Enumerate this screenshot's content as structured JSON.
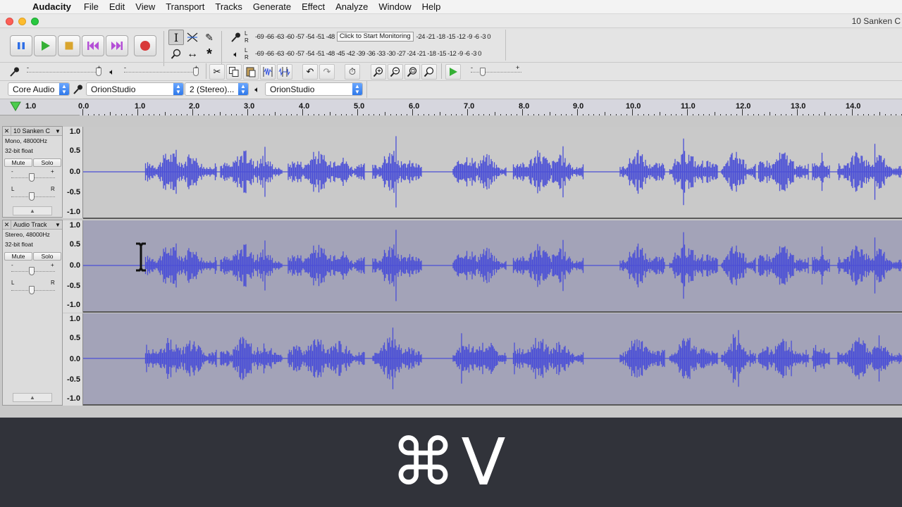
{
  "menubar": {
    "apple_glyph": "",
    "app_name": "Audacity",
    "items": [
      "File",
      "Edit",
      "View",
      "Transport",
      "Tracks",
      "Generate",
      "Effect",
      "Analyze",
      "Window",
      "Help"
    ]
  },
  "window": {
    "title": "10 Sanken C"
  },
  "meters": {
    "record_scale": "-69 -66 -63 -60 -57 -54 -51 -48",
    "record_tooltip": "Click to Start Monitoring",
    "record_scale_right": "-24 -21 -18 -15 -12  -9  -6  -3  0",
    "playback_scale": "-69 -66 -63 -60 -57 -54 -51 -48 -45 -42 -39 -36 -33 -30 -27 -24 -21 -18 -15 -12  -9  -6  -3  0",
    "lr_left": "L",
    "lr_right": "R"
  },
  "slider_marks": {
    "minus": "-",
    "plus": "+"
  },
  "devices": {
    "host": "Core Audio",
    "recording_device": "OrionStudio",
    "channels": "2 (Stereo)...",
    "playback_device": "OrionStudio"
  },
  "timeline": {
    "left_label": "1.0",
    "marks": [
      "0.0",
      "1.0",
      "2.0",
      "3.0",
      "4.0",
      "5.0",
      "6.0",
      "7.0",
      "8.0",
      "9.0",
      "10.0",
      "11.0",
      "12.0",
      "13.0",
      "14.0"
    ]
  },
  "tracks": [
    {
      "name": "10 Sanken C",
      "format": "Mono, 48000Hz",
      "bitdepth": "32-bit float",
      "mute": "Mute",
      "solo": "Solo",
      "gain_minus": "-",
      "gain_plus": "+",
      "pan_left": "L",
      "pan_right": "R",
      "scale": [
        "1.0",
        "0.5",
        "0.0",
        "-0.5",
        "-1.0"
      ]
    },
    {
      "name": "Audio Track",
      "format": "Stereo, 48000Hz",
      "bitdepth": "32-bit float",
      "mute": "Mute",
      "solo": "Solo",
      "gain_minus": "-",
      "gain_plus": "+",
      "pan_left": "L",
      "pan_right": "R",
      "scale_top": [
        "1.0",
        "0.5",
        "0.0",
        "-0.5",
        "-1.0"
      ],
      "scale_bottom": [
        "1.0",
        "0.5",
        "0.0",
        "-0.5",
        "-1.0"
      ]
    }
  ],
  "colors": {
    "waveform": "#4b4fd6",
    "track1_bg": "#c8c8c8",
    "track2_bg": "#a3a3b8",
    "caption_bg": "#31333a"
  },
  "caption": {
    "shortcut": "⌘V"
  }
}
